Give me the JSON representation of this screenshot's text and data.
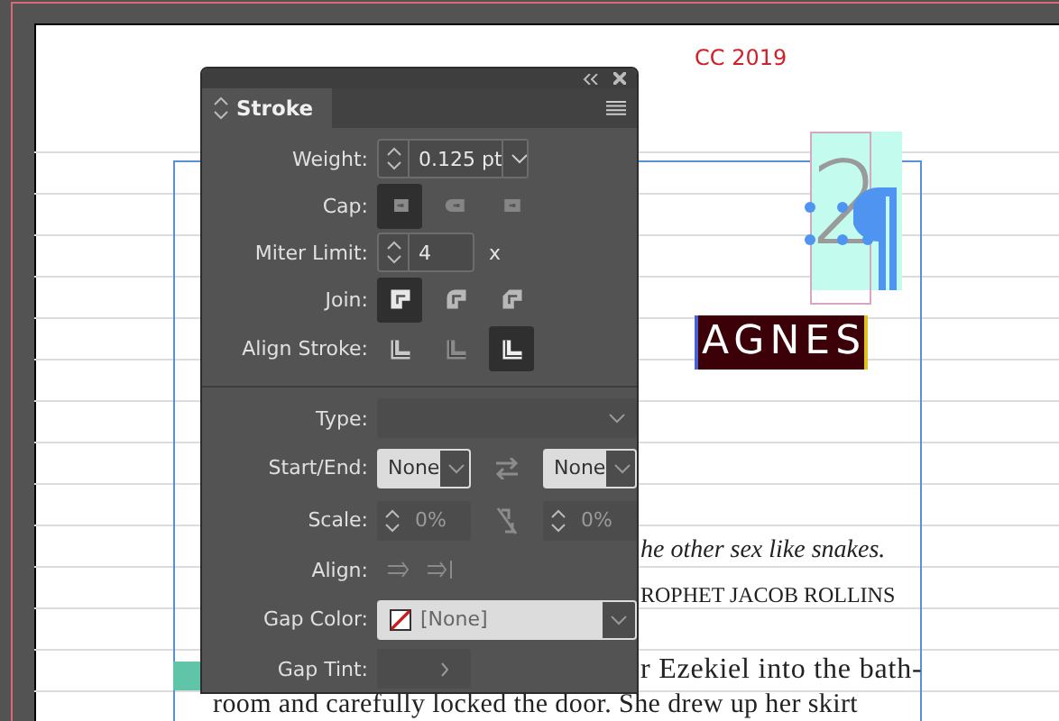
{
  "document": {
    "version_note": "CC 2019",
    "chapter_number": "2",
    "chapter_title": "AGNES",
    "epigraph": "he other sex like snakes.",
    "attribution": "ROPHET JACOB ROLLINS",
    "body_lines": [
      "r Ezekiel into the bath-",
      "room and carefully locked the door. She drew up her skirt"
    ]
  },
  "panel": {
    "tab": {
      "label": "Stroke",
      "selected": true
    },
    "weight": {
      "label": "Weight:",
      "value": "0.125 pt"
    },
    "cap": {
      "label": "Cap:",
      "options": [
        {
          "kind": "butt",
          "selected": true
        },
        {
          "kind": "round",
          "selected": false
        },
        {
          "kind": "square",
          "selected": false
        }
      ]
    },
    "miter_limit": {
      "label": "Miter Limit:",
      "value": "4",
      "unit": "x"
    },
    "join": {
      "label": "Join:",
      "options": [
        {
          "kind": "miter",
          "selected": true
        },
        {
          "kind": "round",
          "selected": false
        },
        {
          "kind": "bevel",
          "selected": false
        }
      ]
    },
    "align_stroke": {
      "label": "Align Stroke:",
      "options": [
        {
          "kind": "center",
          "selected": false
        },
        {
          "kind": "inside",
          "selected": false
        },
        {
          "kind": "outside",
          "selected": true
        }
      ]
    },
    "type": {
      "label": "Type:"
    },
    "start_end": {
      "label": "Start/End:",
      "start": "None",
      "end": "None"
    },
    "scale": {
      "label": "Scale:",
      "start": "0%",
      "end": "0%"
    },
    "align": {
      "label": "Align:"
    },
    "gap_color": {
      "label": "Gap Color:",
      "value": "[None]"
    },
    "gap_tint": {
      "label": "Gap Tint:"
    }
  }
}
